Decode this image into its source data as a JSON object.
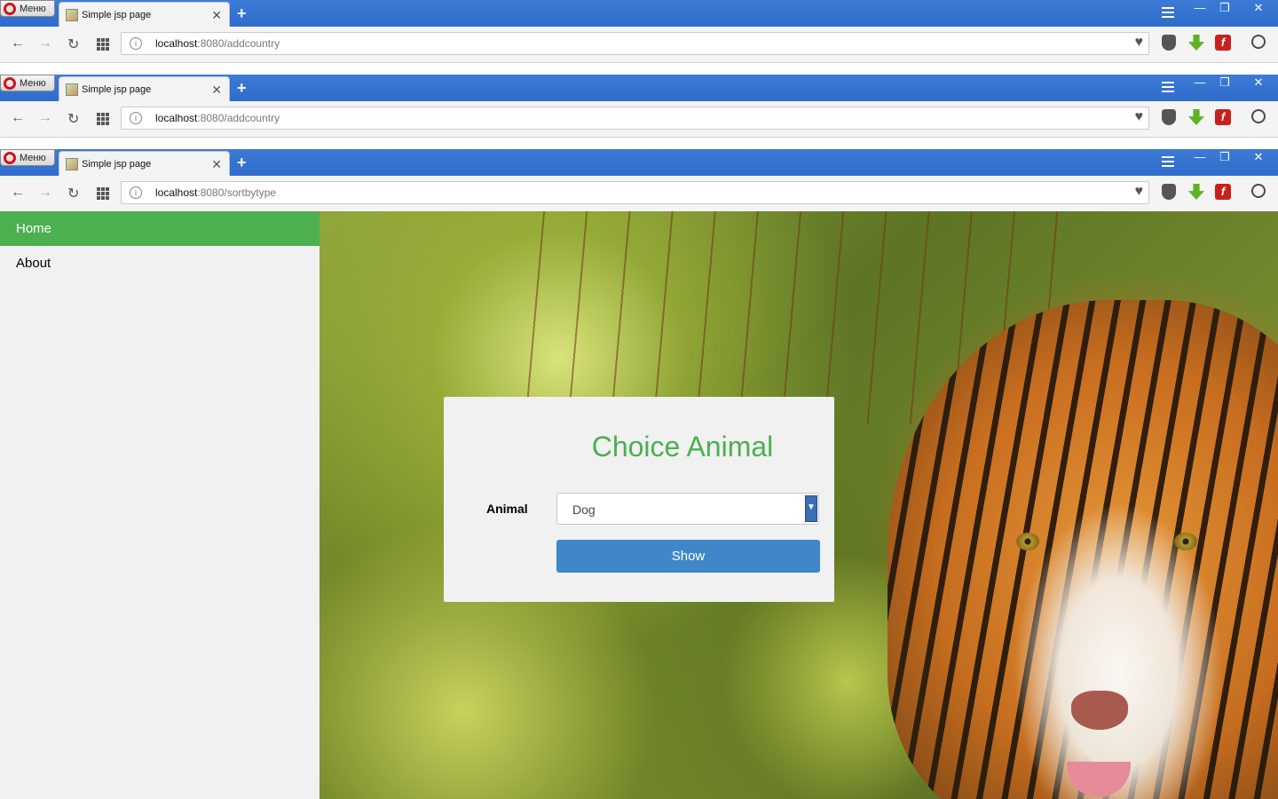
{
  "browser": {
    "menu_label": "Меню",
    "windows": [
      {
        "tab_title": "Simple jsp page",
        "url_host": "localhost",
        "url_path": ":8080/addcountry"
      },
      {
        "tab_title": "Simple jsp page",
        "url_host": "localhost",
        "url_path": ":8080/addcountry"
      },
      {
        "tab_title": "Simple jsp page",
        "url_host": "localhost",
        "url_path": ":8080/sortbytype"
      }
    ]
  },
  "sidebar": {
    "items": [
      {
        "label": "Home",
        "active": true
      },
      {
        "label": "About",
        "active": false
      }
    ]
  },
  "form": {
    "title": "Choice Animal",
    "animal_label": "Animal",
    "animal_selected": "Dog",
    "show_label": "Show"
  },
  "colors": {
    "accent_green": "#4caf50",
    "button_blue": "#3f87c8",
    "tabbar_blue": "#2f6ccb"
  }
}
